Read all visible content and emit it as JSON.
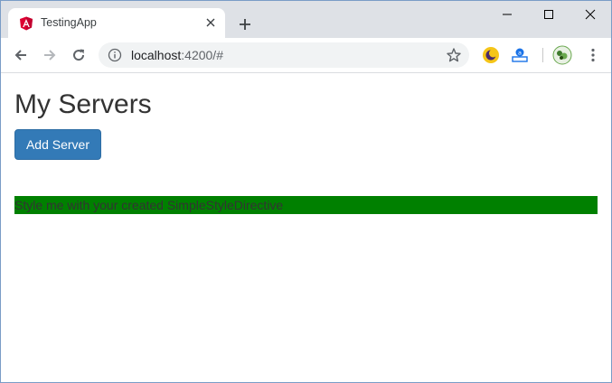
{
  "browser": {
    "tab": {
      "title": "TestingApp",
      "favicon": "angular-logo-icon"
    },
    "address_bar": {
      "host": "localhost",
      "path": ":4200/#"
    },
    "window_controls": [
      "minimize-icon",
      "maximize-icon",
      "close-icon"
    ],
    "extensions": [
      "moon-extension-icon",
      "translate-extension-icon",
      "avatar-extension-icon"
    ]
  },
  "page": {
    "title": "My Servers",
    "add_server_label": "Add Server",
    "directive_text": "Style me with your created SimpleStyleDirective",
    "directive_bg": "#008000"
  },
  "colors": {
    "primary_button": "#337ab7",
    "tabstrip": "#dee1e6",
    "angular_red": "#dd0031"
  }
}
